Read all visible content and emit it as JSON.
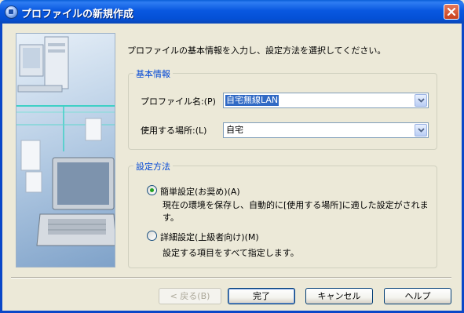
{
  "window": {
    "title": "プロファイルの新規作成"
  },
  "intro_text": "プロファイルの基本情報を入力し、設定方法を選択してください。",
  "basic_info": {
    "group_title": "基本情報",
    "profile_name_label": "プロファイル名:(P)",
    "profile_name_value": "自宅無線LAN",
    "location_label": "使用する場所:(L)",
    "location_value": "自宅"
  },
  "setup_method": {
    "group_title": "設定方法",
    "simple": {
      "label": "簡単設定(お奨め)(A)",
      "description": "現在の環境を保存し、自動的に[使用する場所]に適した設定がされます。",
      "selected": true
    },
    "advanced": {
      "label": "詳細設定(上級者向け)(M)",
      "description": "設定する項目をすべて指定します。",
      "selected": false
    }
  },
  "buttons": {
    "back": "< 戻る(B)",
    "finish": "完了",
    "cancel": "キャンセル",
    "help": "ヘルプ"
  },
  "colors": {
    "titlebar": "#0450d6",
    "group_title": "#0046d5",
    "selection": "#316ac5",
    "radio_dot": "#21a121",
    "close_button": "#c9401d"
  }
}
